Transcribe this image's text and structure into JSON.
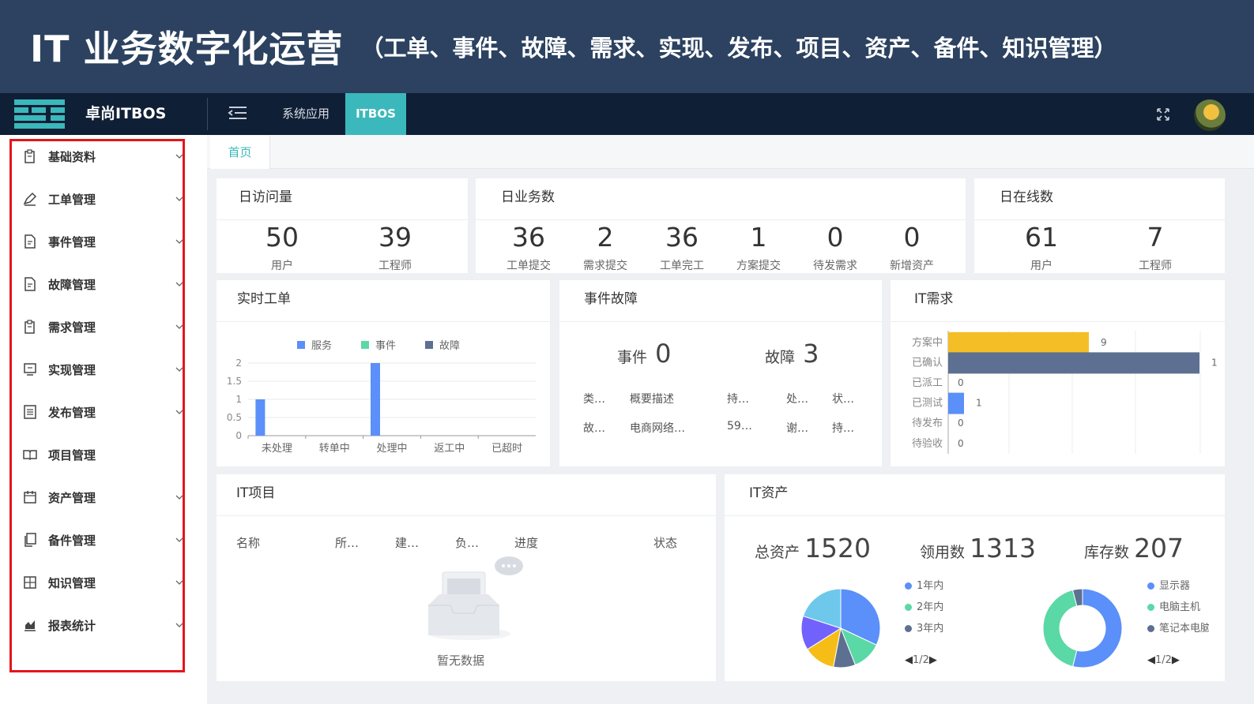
{
  "banner": {
    "title": "IT 业务数字化运营",
    "subtitle": "（工单、事件、故障、需求、实现、发布、项目、资产、备件、知识管理）"
  },
  "topnav": {
    "brand": "卓尚ITBOS",
    "tab_system": "系统应用",
    "tab_itbos": "ITBOS",
    "accent_color": "#3bb8bb"
  },
  "sidebar": {
    "items": [
      {
        "label": "基础资料",
        "icon": "clipboard-icon"
      },
      {
        "label": "工单管理",
        "icon": "pen-icon"
      },
      {
        "label": "事件管理",
        "icon": "doc-icon"
      },
      {
        "label": "故障管理",
        "icon": "doc-icon"
      },
      {
        "label": "需求管理",
        "icon": "clipboard-icon"
      },
      {
        "label": "实现管理",
        "icon": "monitor-icon"
      },
      {
        "label": "发布管理",
        "icon": "list-icon"
      },
      {
        "label": "项目管理",
        "icon": "book-icon"
      },
      {
        "label": "资产管理",
        "icon": "calendar-icon"
      },
      {
        "label": "备件管理",
        "icon": "copy-icon"
      },
      {
        "label": "知识管理",
        "icon": "grid-icon"
      },
      {
        "label": "报表统计",
        "icon": "chart-icon"
      }
    ]
  },
  "tabs": {
    "home": "首页"
  },
  "daily_visits": {
    "title": "日访问量",
    "stats": [
      {
        "value": "50",
        "label": "用户"
      },
      {
        "value": "39",
        "label": "工程师"
      }
    ]
  },
  "daily_business": {
    "title": "日业务数",
    "stats": [
      {
        "value": "36",
        "label": "工单提交"
      },
      {
        "value": "2",
        "label": "需求提交"
      },
      {
        "value": "36",
        "label": "工单完工"
      },
      {
        "value": "1",
        "label": "方案提交"
      },
      {
        "value": "0",
        "label": "待发需求"
      },
      {
        "value": "0",
        "label": "新增资产"
      }
    ]
  },
  "daily_online": {
    "title": "日在线数",
    "stats": [
      {
        "value": "61",
        "label": "用户"
      },
      {
        "value": "7",
        "label": "工程师"
      }
    ]
  },
  "realtime_orders": {
    "title": "实时工单"
  },
  "incidents": {
    "title": "事件故障",
    "event_label": "事件",
    "event_value": "0",
    "fault_label": "故障",
    "fault_value": "3",
    "columns": [
      "类…",
      "概要描述",
      "持…",
      "处…",
      "状…"
    ],
    "rows": [
      [
        "故…",
        "电商网络…",
        "59…",
        "谢…",
        "持…"
      ]
    ]
  },
  "it_demand": {
    "title": "IT需求"
  },
  "it_projects": {
    "title": "IT项目",
    "columns": [
      "名称",
      "所…",
      "建…",
      "负…",
      "进度",
      "状态"
    ],
    "empty_text": "暂无数据"
  },
  "it_assets": {
    "title": "IT资产",
    "total_label": "总资产",
    "total_value": "1520",
    "used_label": "领用数",
    "used_value": "1313",
    "stock_label": "库存数",
    "stock_value": "207",
    "age_legend": [
      "1年内",
      "2年内",
      "3年内"
    ],
    "type_legend": [
      "显示器",
      "电脑主机",
      "笔记本电脑"
    ],
    "pager": "1/2"
  },
  "chart_data": [
    {
      "type": "bar",
      "categories": [
        "未处理",
        "转单中",
        "处理中",
        "返工中",
        "已超时"
      ],
      "series": [
        {
          "name": "服务",
          "values": [
            1,
            0,
            2,
            0,
            0
          ],
          "color": "#5b8ff9"
        },
        {
          "name": "事件",
          "values": [
            0,
            0,
            0,
            0,
            0
          ],
          "color": "#5ad8a6"
        },
        {
          "name": "故障",
          "values": [
            0,
            0,
            0,
            0,
            0
          ],
          "color": "#5d7092"
        }
      ],
      "ylim": [
        0,
        2
      ],
      "yticks": [
        "0",
        "0.5",
        "1",
        "1.5",
        "2"
      ],
      "legend": "top-center"
    },
    {
      "type": "bar",
      "orientation": "horizontal",
      "categories": [
        "方案中",
        "已确认",
        "已派工",
        "已测试",
        "待发布",
        "待验收"
      ],
      "values": [
        9,
        1,
        0,
        1,
        0,
        0
      ],
      "colors": [
        "#f4be26",
        "#5d7092",
        "#5b8ff9",
        "#5b8ff9",
        "#5b8ff9",
        "#5b8ff9"
      ]
    },
    {
      "type": "pie",
      "slices": [
        {
          "name": "1年内",
          "value": 32,
          "color": "#5b8ff9"
        },
        {
          "name": "2年内",
          "value": 12,
          "color": "#5ad8a6"
        },
        {
          "name": "3年内",
          "value": 9,
          "color": "#5d7092"
        },
        {
          "name": "",
          "value": 13,
          "color": "#f6bd16"
        },
        {
          "name": "",
          "value": 14,
          "color": "#7262fd"
        },
        {
          "name": "",
          "value": 20,
          "color": "#6dc8ec"
        }
      ]
    },
    {
      "type": "pie",
      "donut": true,
      "slices": [
        {
          "name": "显示器",
          "value": 54,
          "color": "#5b8ff9"
        },
        {
          "name": "电脑主机",
          "value": 42,
          "color": "#5ad8a6"
        },
        {
          "name": "笔记本电脑",
          "value": 4,
          "color": "#5d7092"
        }
      ]
    }
  ]
}
